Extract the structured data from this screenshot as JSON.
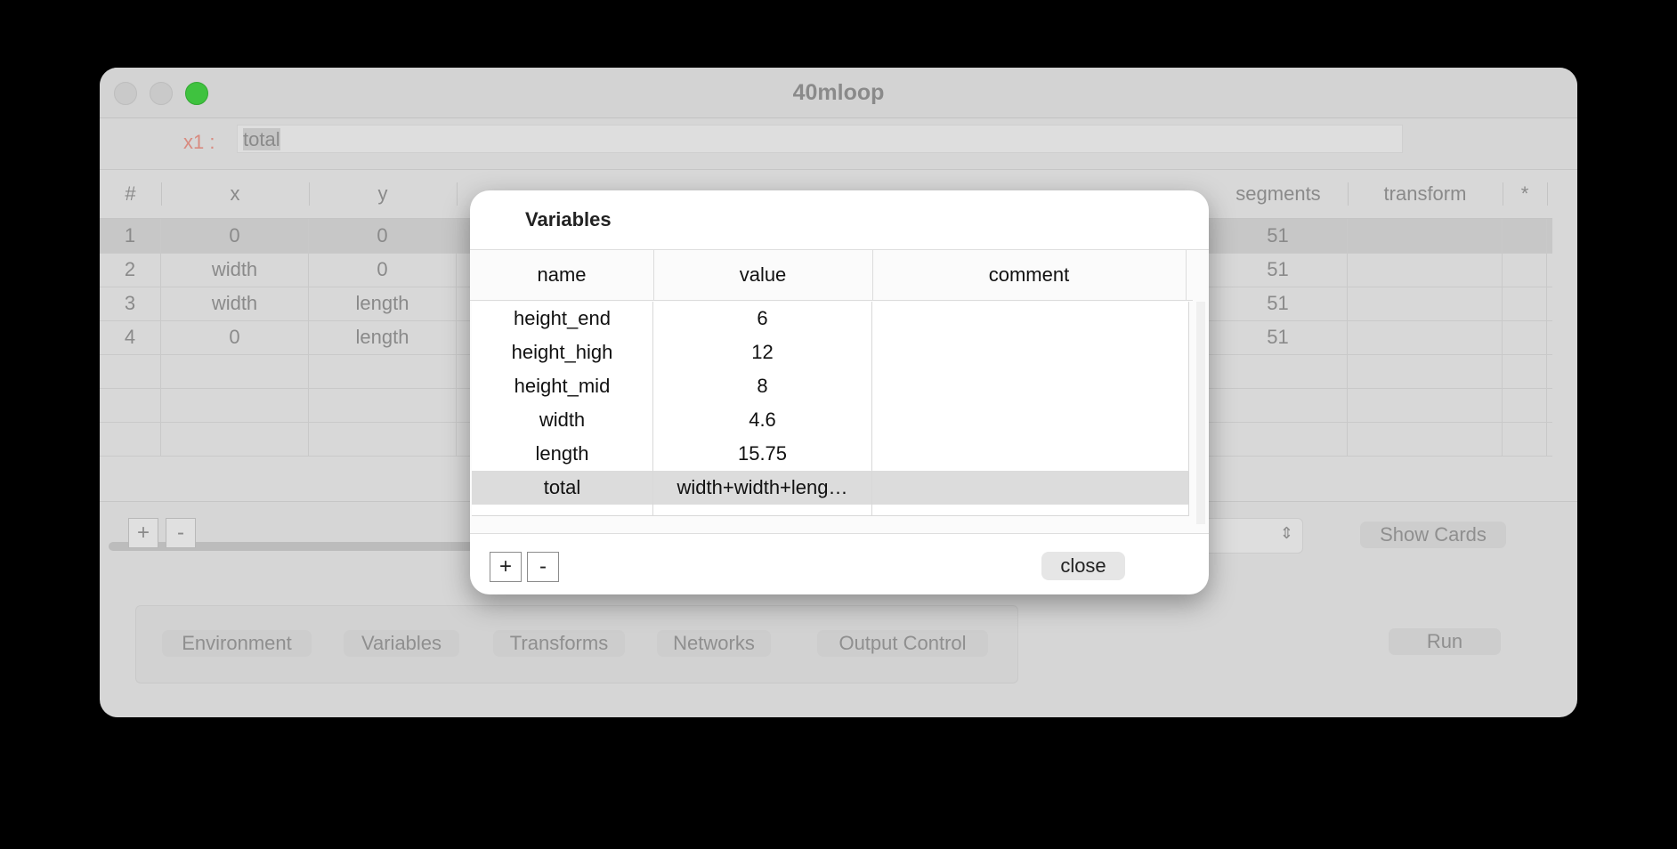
{
  "window": {
    "title": "40mloop"
  },
  "formula": {
    "label": "x1 :",
    "value": "total"
  },
  "grid": {
    "columns": [
      "#",
      "x",
      "y",
      "segments",
      "transform",
      "*"
    ],
    "rows": [
      {
        "num": "1",
        "x": "0",
        "y": "0",
        "segments": "51"
      },
      {
        "num": "2",
        "x": "width",
        "y": "0",
        "segments": "51"
      },
      {
        "num": "3",
        "x": "width",
        "y": "length",
        "segments": "51"
      },
      {
        "num": "4",
        "x": "0",
        "y": "length",
        "segments": "51"
      }
    ]
  },
  "grid_controls": {
    "add": "+",
    "remove": "-"
  },
  "buttons": {
    "show_cards": "Show Cards",
    "run": "Run"
  },
  "tabs": [
    "Environment",
    "Variables",
    "Transforms",
    "Networks",
    "Output Control"
  ],
  "dialog": {
    "title": "Variables",
    "columns": {
      "name": "name",
      "value": "value",
      "comment": "comment"
    },
    "rows": [
      {
        "name": "height_end",
        "value": "6",
        "comment": ""
      },
      {
        "name": "height_high",
        "value": "12",
        "comment": ""
      },
      {
        "name": "height_mid",
        "value": "8",
        "comment": ""
      },
      {
        "name": "width",
        "value": "4.6",
        "comment": ""
      },
      {
        "name": "length",
        "value": "15.75",
        "comment": ""
      },
      {
        "name": "total",
        "value": "width+width+leng…",
        "comment": ""
      }
    ],
    "add": "+",
    "remove": "-",
    "close": "close"
  },
  "icons": {
    "select_chevron": "chevron-updown-icon"
  }
}
